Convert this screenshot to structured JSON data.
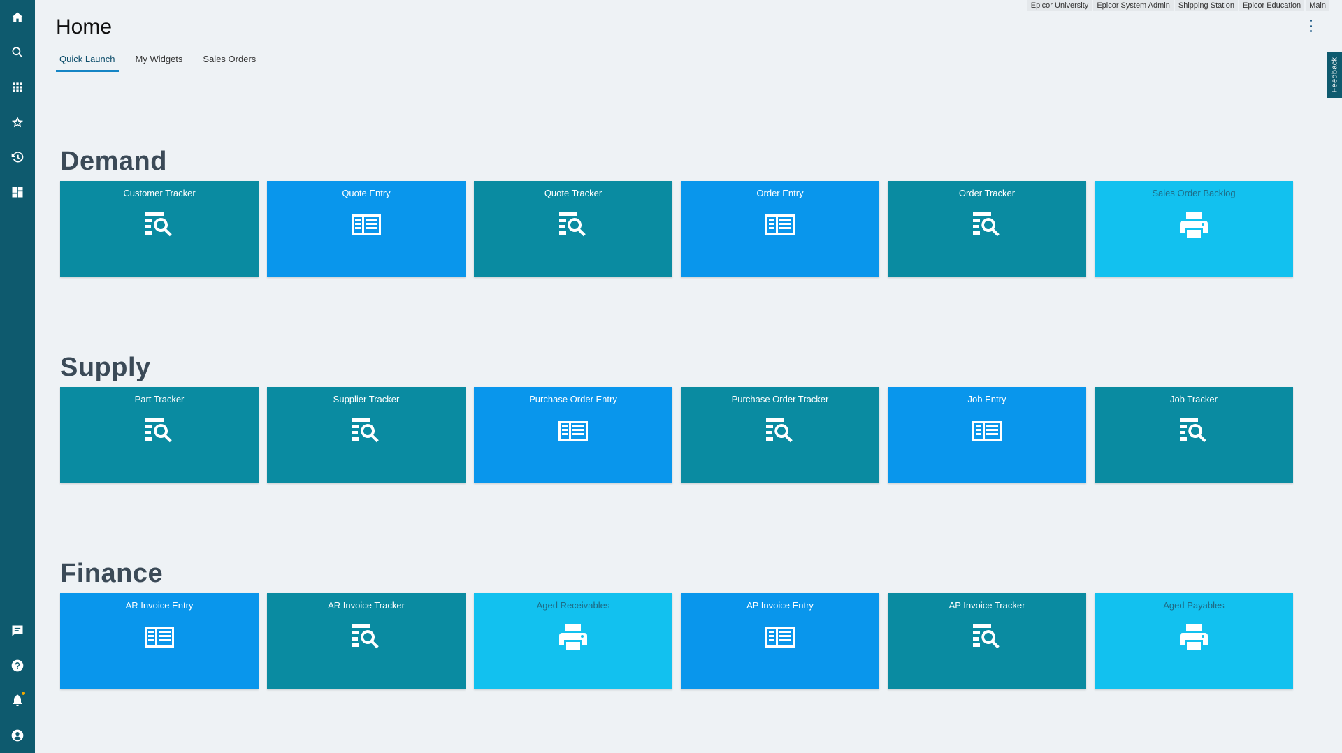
{
  "header": {
    "title": "Home",
    "top_links": [
      "Epicor University",
      "Epicor System Admin",
      "Shipping Station",
      "Epicor Education",
      "Main"
    ],
    "feedback_label": "Feedback"
  },
  "tabs": [
    {
      "label": "Quick Launch",
      "active": true
    },
    {
      "label": "My Widgets",
      "active": false
    },
    {
      "label": "Sales Orders",
      "active": false
    }
  ],
  "sidebar": {
    "top_icons": [
      "home-icon",
      "search-icon",
      "apps-grid-icon",
      "star-icon",
      "history-icon",
      "dashboard-icon"
    ],
    "bottom_icons": [
      "chat-icon",
      "help-icon",
      "bell-icon",
      "user-icon"
    ]
  },
  "colors": {
    "teal": "#0a8ba1",
    "blue": "#0996ec",
    "light": "#12c1ef",
    "sidebar": "#0e5a6e"
  },
  "sections": [
    {
      "title": "Demand",
      "tiles": [
        {
          "label": "Customer Tracker",
          "style": "teal",
          "icon": "tracker-search-icon"
        },
        {
          "label": "Quote Entry",
          "style": "blue",
          "icon": "entry-form-icon"
        },
        {
          "label": "Quote Tracker",
          "style": "teal",
          "icon": "tracker-search-icon"
        },
        {
          "label": "Order Entry",
          "style": "blue",
          "icon": "entry-form-icon"
        },
        {
          "label": "Order Tracker",
          "style": "teal",
          "icon": "tracker-search-icon"
        },
        {
          "label": "Sales Order Backlog",
          "style": "light",
          "icon": "printer-icon"
        }
      ]
    },
    {
      "title": "Supply",
      "tiles": [
        {
          "label": "Part Tracker",
          "style": "teal",
          "icon": "tracker-search-icon"
        },
        {
          "label": "Supplier Tracker",
          "style": "teal",
          "icon": "tracker-search-icon"
        },
        {
          "label": "Purchase Order Entry",
          "style": "blue",
          "icon": "entry-form-icon"
        },
        {
          "label": "Purchase Order Tracker",
          "style": "teal",
          "icon": "tracker-search-icon"
        },
        {
          "label": "Job Entry",
          "style": "blue",
          "icon": "entry-form-icon"
        },
        {
          "label": "Job Tracker",
          "style": "teal",
          "icon": "tracker-search-icon"
        }
      ]
    },
    {
      "title": "Finance",
      "tiles": [
        {
          "label": "AR Invoice Entry",
          "style": "blue",
          "icon": "entry-form-icon"
        },
        {
          "label": "AR Invoice Tracker",
          "style": "teal",
          "icon": "tracker-search-icon"
        },
        {
          "label": "Aged Receivables",
          "style": "light",
          "icon": "printer-icon"
        },
        {
          "label": "AP Invoice Entry",
          "style": "blue",
          "icon": "entry-form-icon"
        },
        {
          "label": "AP Invoice Tracker",
          "style": "teal",
          "icon": "tracker-search-icon"
        },
        {
          "label": "Aged Payables",
          "style": "light",
          "icon": "printer-icon"
        }
      ]
    }
  ]
}
